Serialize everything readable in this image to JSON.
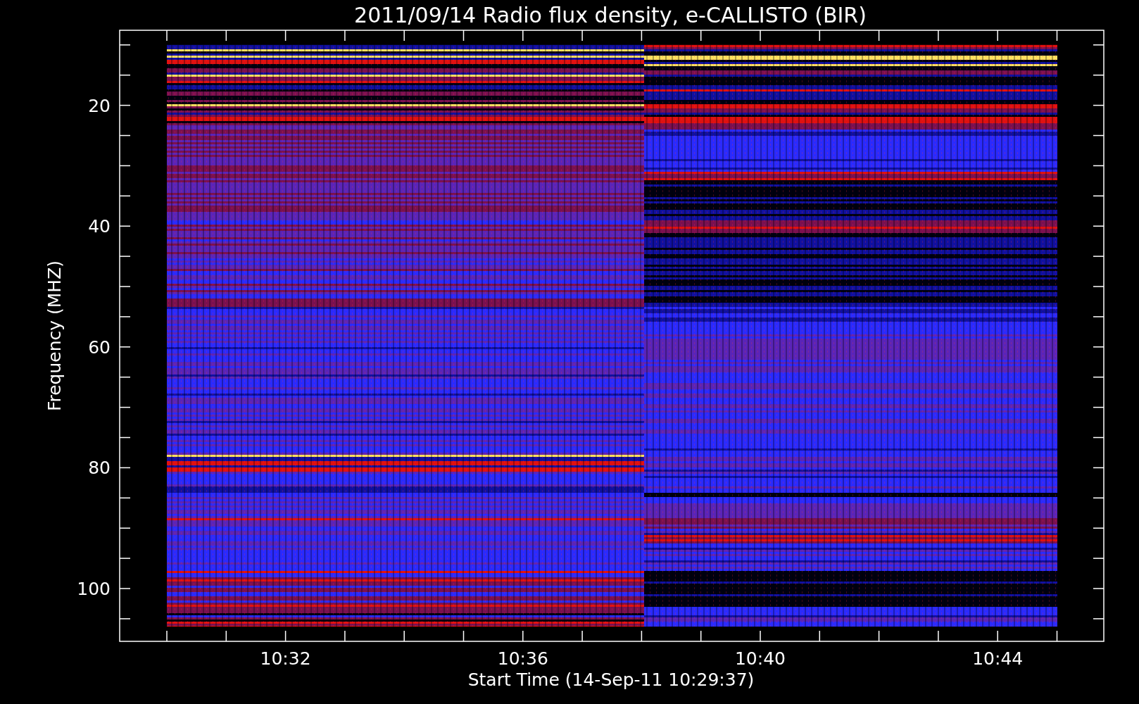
{
  "plot": {
    "title": "2011/09/14  Radio flux density, e-CALLISTO (BIR)",
    "ylabel": "Frequency (MHZ)",
    "xlabel": "Start Time (14-Sep-11 10:29:37)",
    "yticks": [
      "20",
      "40",
      "60",
      "80",
      "100"
    ],
    "xticks": [
      "10:32",
      "10:36",
      "10:40",
      "10:44"
    ]
  }
}
